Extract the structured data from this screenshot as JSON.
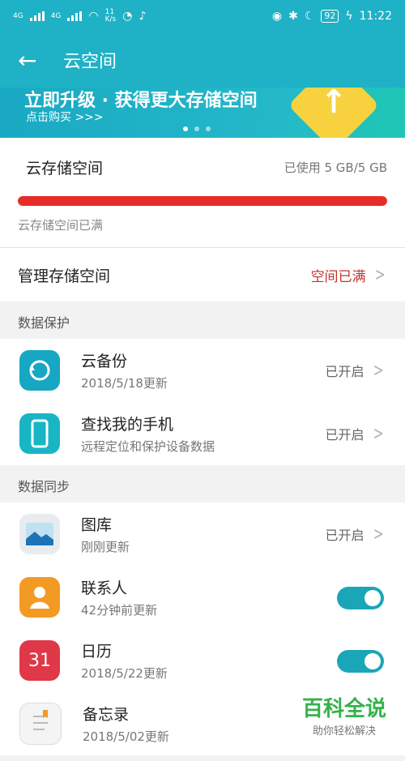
{
  "status_bar": {
    "network_left": "4G",
    "network_right": "4G",
    "speed_top": "11",
    "speed_bottom": "K/s",
    "battery": "92",
    "time": "11:22"
  },
  "app_bar": {
    "title": "云空间"
  },
  "banner": {
    "headline": "立即升级 · 获得更大存储空间",
    "subline": "点击购买 >>>"
  },
  "storage": {
    "label": "云存储空间",
    "used_text": "已使用 5 GB/5 GB",
    "used_fraction": 1.0,
    "bar_color": "#e52d27",
    "full_note": "云存储空间已满"
  },
  "manage": {
    "label": "管理存储空间",
    "status": "空间已满"
  },
  "data_protection": {
    "title": "数据保护",
    "items": [
      {
        "name": "云备份",
        "sub": "2018/5/18更新",
        "status": "已开启",
        "icon": "cloud-backup-icon"
      },
      {
        "name": "查找我的手机",
        "sub": "远程定位和保护设备数据",
        "status": "已开启",
        "icon": "phone-find-icon"
      }
    ]
  },
  "data_sync": {
    "title": "数据同步",
    "items": [
      {
        "name": "图库",
        "sub": "刚刚更新",
        "status": "已开启",
        "icon": "gallery-icon"
      },
      {
        "name": "联系人",
        "sub": "42分钟前更新",
        "toggle": true,
        "icon": "contacts-icon"
      },
      {
        "name": "日历",
        "sub": "2018/5/22更新",
        "toggle": true,
        "icon": "calendar-icon",
        "icon_text": "31"
      },
      {
        "name": "备忘录",
        "sub": "2018/5/02更新",
        "icon": "notes-icon"
      }
    ]
  },
  "watermark": {
    "title": "百科全说",
    "subtitle": "助你轻松解决"
  },
  "colors": {
    "brand": "#1fb1c6",
    "danger": "#c0352d",
    "toggle_on": "#1ba6b7"
  }
}
